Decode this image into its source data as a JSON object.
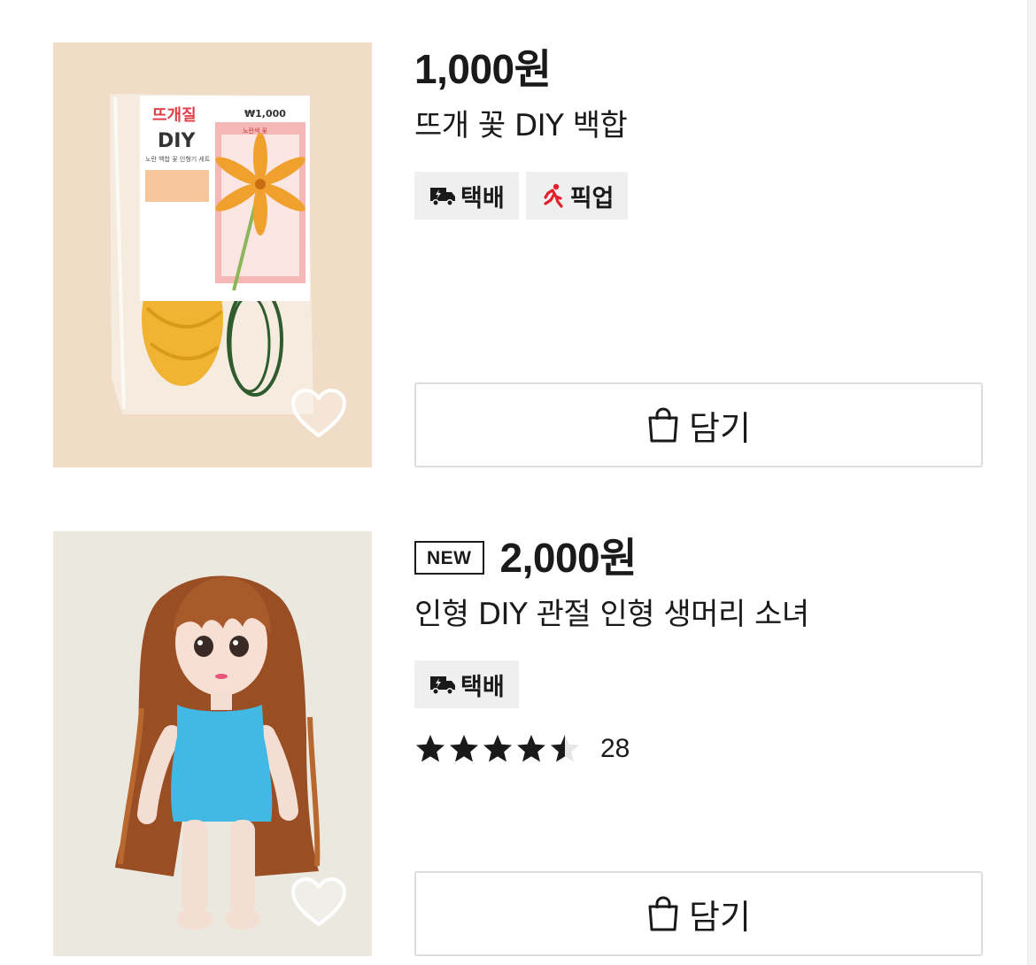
{
  "products": [
    {
      "price": "1,000원",
      "is_new": false,
      "name": "뜨개 꽃 DIY 백합",
      "tags": [
        {
          "label": "택배",
          "icon": "delivery-truck-icon"
        },
        {
          "label": "픽업",
          "icon": "running-person-icon"
        }
      ],
      "cart_label": "담기",
      "package_text": {
        "brand": "뜨개질",
        "brand_sub": "DIY",
        "tagline": "노란 백합 꽃 인형기 세트",
        "price_tag": "₩1,000",
        "card_label": "노란색 꽃"
      }
    },
    {
      "price": "2,000원",
      "is_new": true,
      "new_label": "NEW",
      "name": "인형 DIY 관절 인형 생머리 소녀",
      "tags": [
        {
          "label": "택배",
          "icon": "delivery-truck-icon"
        }
      ],
      "rating": 4.5,
      "review_count": "28",
      "cart_label": "담기"
    }
  ],
  "colors": {
    "text": "#1a1a1a",
    "tag_bg": "#efefef",
    "pickup_icon": "#e3202b",
    "button_border": "#dcdcdc",
    "thumb1_bg": "#f1dcc8",
    "thumb2_bg": "#eae8df"
  }
}
